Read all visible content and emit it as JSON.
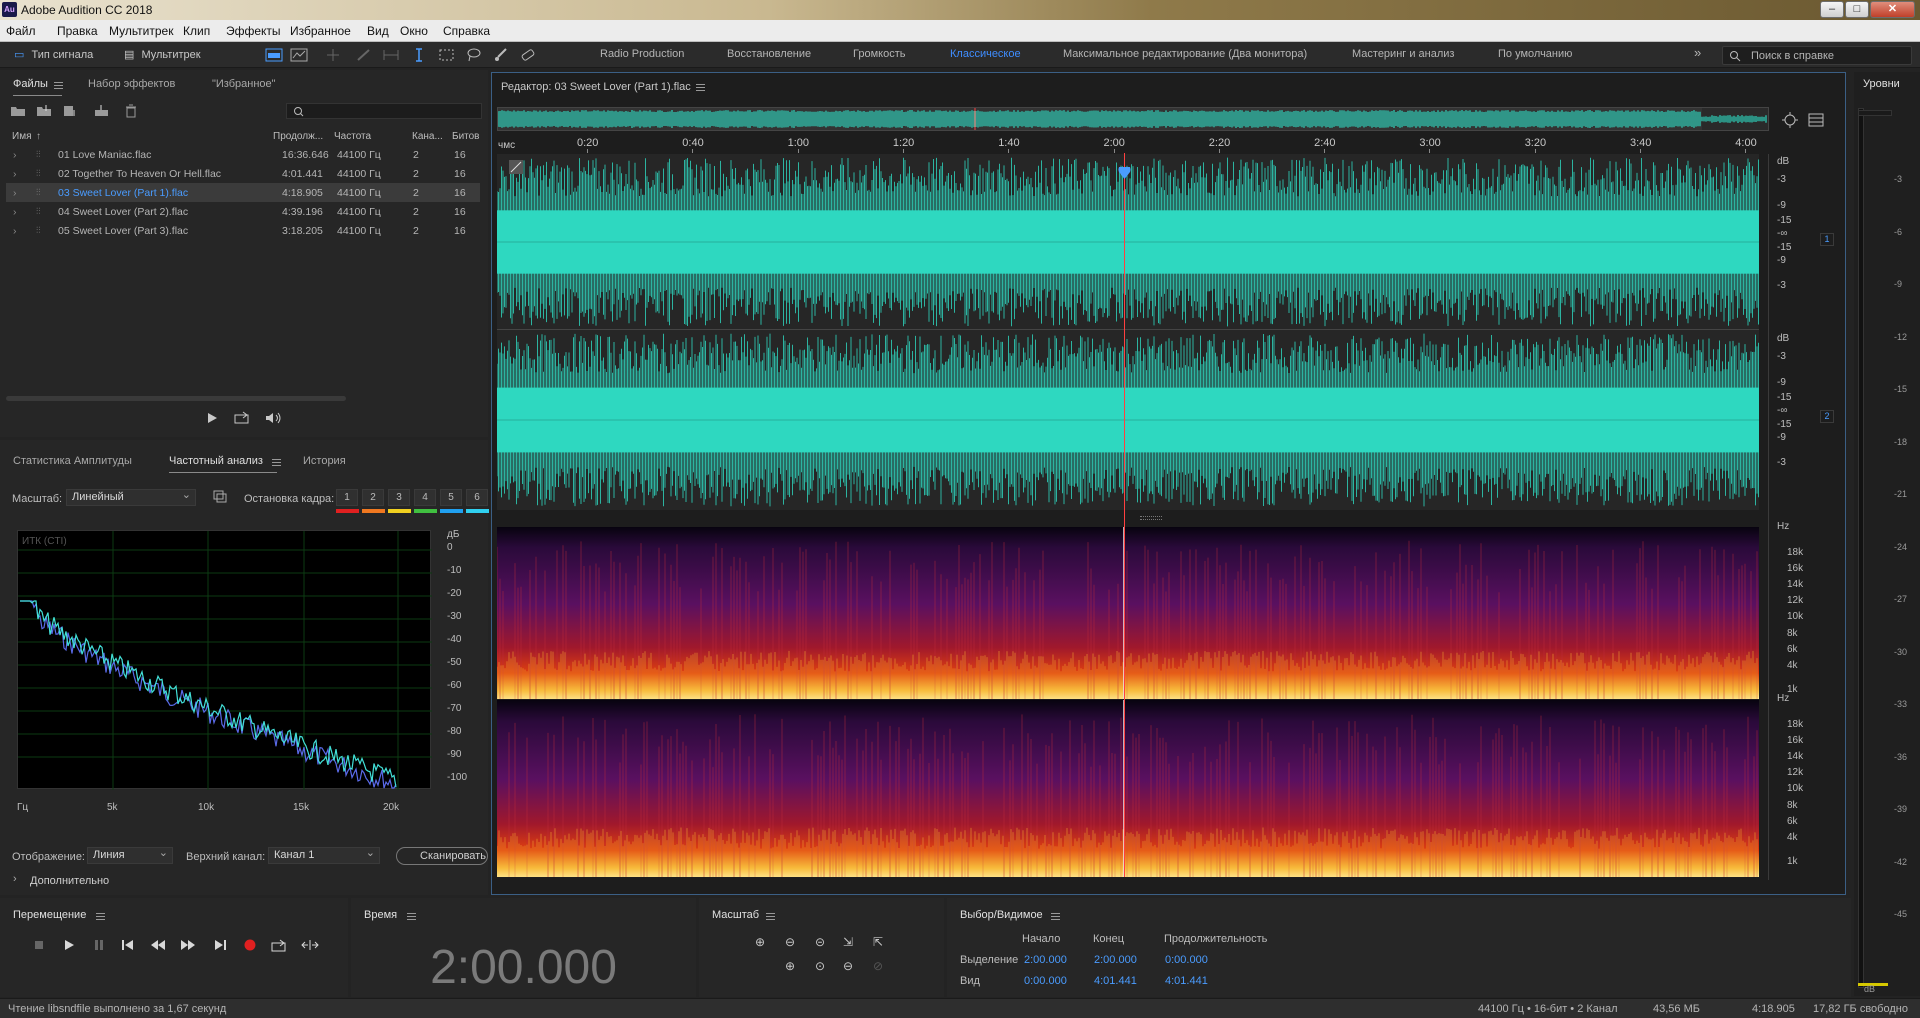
{
  "window": {
    "title": "Adobe Audition CC 2018",
    "app_icon": "Au"
  },
  "menu": [
    "Файл",
    "Правка",
    "Мультитрек",
    "Клип",
    "Эффекты",
    "Избранное",
    "Вид",
    "Окно",
    "Справка"
  ],
  "toolbar": {
    "waveform_label": "Тип сигнала",
    "multitrack_label": "Мультитрек",
    "workspaces": [
      "Radio Production",
      "Восстановление",
      "Громкость",
      "Классическое",
      "Максимальное редактирование (Два монитора)",
      "Мастеринг и анализ",
      "По умолчанию"
    ],
    "active_workspace": "Классическое",
    "help_placeholder": "Поиск в справке",
    "more": "»"
  },
  "files_panel": {
    "tabs": [
      "Файлы",
      "Набор эффектов",
      "\"Избранное\""
    ],
    "columns": [
      "Имя",
      "Продолж...",
      "Частота",
      "Кана...",
      "Битов"
    ],
    "rows": [
      {
        "name": "01 Love Maniac.flac",
        "duration": "16:36.646",
        "rate": "44100 Гц",
        "ch": "2",
        "bits": "16"
      },
      {
        "name": "02 Together To Heaven Or Hell.flac",
        "duration": "4:01.441",
        "rate": "44100 Гц",
        "ch": "2",
        "bits": "16"
      },
      {
        "name": "03 Sweet Lover (Part 1).flac",
        "duration": "4:18.905",
        "rate": "44100 Гц",
        "ch": "2",
        "bits": "16"
      },
      {
        "name": "04 Sweet Lover (Part 2).flac",
        "duration": "4:39.196",
        "rate": "44100 Гц",
        "ch": "2",
        "bits": "16"
      },
      {
        "name": "05 Sweet Lover (Part 3).flac",
        "duration": "3:18.205",
        "rate": "44100 Гц",
        "ch": "2",
        "bits": "16"
      }
    ],
    "selected_index": 2
  },
  "analysis_panel": {
    "tabs": [
      "Статистика Амплитуды",
      "Частотный анализ",
      "История"
    ],
    "scale_label": "Масштаб:",
    "scale_value": "Линейный",
    "freeze_label": "Остановка кадра:",
    "freeze_slots": [
      "1",
      "2",
      "3",
      "4",
      "5",
      "6"
    ],
    "freeze_colors": [
      "#e02020",
      "#f07820",
      "#f0d020",
      "#40c040",
      "#20a0f0",
      "#30d0f0"
    ],
    "graph_label": "ИТК (CTI)",
    "db_unit": "дБ",
    "db_ticks": [
      "0",
      "-10",
      "-20",
      "-30",
      "-40",
      "-50",
      "-60",
      "-70",
      "-80",
      "-90",
      "-100"
    ],
    "freq_ticks": [
      "Гц",
      "5k",
      "10k",
      "15k",
      "20k"
    ],
    "display_label": "Отображение:",
    "display_value": "Линия",
    "channel_label": "Верхний канал:",
    "channel_value": "Канал 1",
    "scan_button": "Сканировать",
    "more_label": "Дополнительно"
  },
  "editor": {
    "title": "Редактор: 03 Sweet Lover (Part 1).flac",
    "ruler_unit": "чмс",
    "ruler_labels": [
      "0:20",
      "0:40",
      "1:00",
      "1:20",
      "1:40",
      "2:00",
      "2:20",
      "2:40",
      "3:00",
      "3:20",
      "3:40",
      "4:00"
    ],
    "db_unit": "dB",
    "db_labels": [
      "-3",
      "-9",
      "-15",
      "-∞",
      "-15",
      "-9",
      "-3"
    ],
    "channels": [
      "1",
      "2"
    ],
    "hz_unit": "Hz",
    "hz_labels": [
      "18k",
      "16k",
      "14k",
      "12k",
      "10k",
      "8k",
      "6k",
      "4k",
      "1k"
    ],
    "waveform_color": "#2fd8c0",
    "playhead_color": "#ff4040"
  },
  "level_panel": {
    "title": "Уровни",
    "ticks": [
      "-3",
      "-6",
      "-9",
      "-12",
      "-15",
      "-18",
      "-21",
      "-24",
      "-27",
      "-30",
      "-33",
      "-36",
      "-39",
      "-42",
      "-45"
    ],
    "unit": "dB"
  },
  "transport": {
    "title": "Перемещение",
    "record_color": "#e02020"
  },
  "time_panel": {
    "title": "Время",
    "value": "2:00.000"
  },
  "zoom_panel": {
    "title": "Масштаб"
  },
  "selection_panel": {
    "title": "Выбор/Видимое",
    "col_start": "Начало",
    "col_end": "Конец",
    "col_duration": "Продолжительность",
    "selection": {
      "label": "Выделение",
      "start": "2:00.000",
      "end": "2:00.000",
      "duration": "0:00.000"
    },
    "view": {
      "label": "Вид",
      "start": "0:00.000",
      "end": "4:01.441",
      "duration": "4:01.441"
    }
  },
  "statusbar": {
    "left": "Чтение libsndfile выполнено за 1,67 секунд",
    "format": "44100 Гц • 16-бит • 2 Канал",
    "size": "43,56 МБ",
    "duration": "4:18.905",
    "free": "17,82 ГБ свободно"
  }
}
